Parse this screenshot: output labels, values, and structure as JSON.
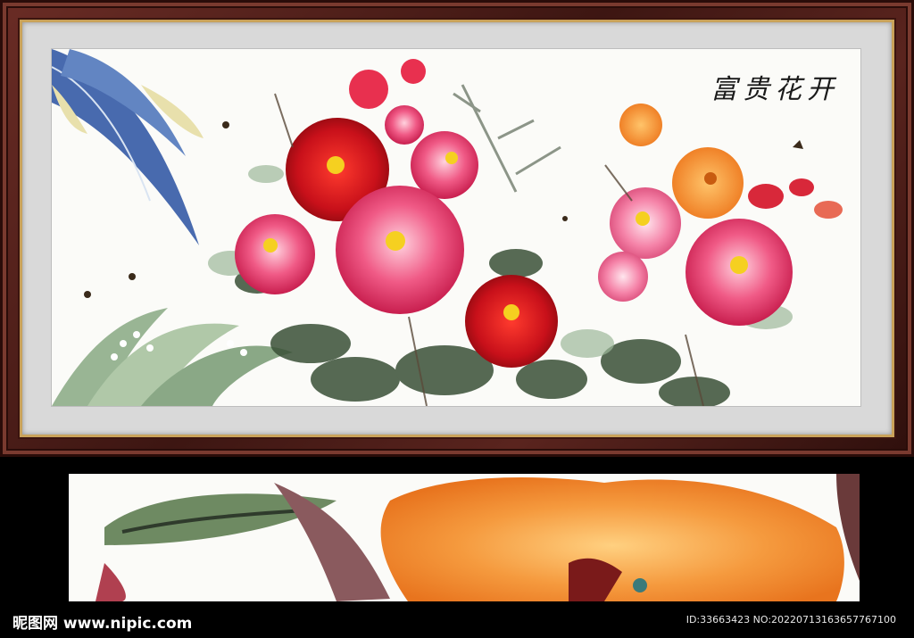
{
  "painting": {
    "calligraphy": "富贵花开",
    "colors": {
      "red_peony": "#d41a1a",
      "pink_peony": "#ec4a7a",
      "orange_peony": "#f28a2e",
      "banana_leaf": "#3a5fa8",
      "foliage": "#3d5a3a",
      "frame": "#4a1c16",
      "mat": "#d9d9d9"
    }
  },
  "watermark": {
    "site_cn": "昵图网",
    "site_url": "www.nipic.com",
    "id_text": "ID:33663423 NO:20220713163657767100"
  }
}
